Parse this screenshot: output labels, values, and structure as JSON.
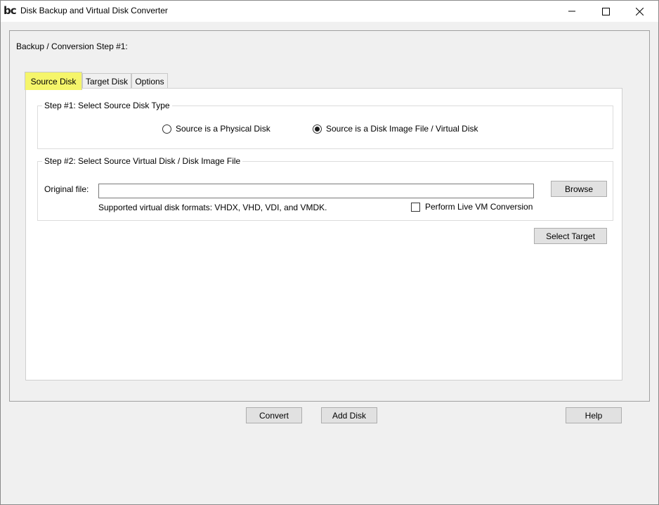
{
  "window": {
    "logo": "bc",
    "title": "Disk Backup and Virtual Disk Converter",
    "controls": [
      "minimize",
      "maximize",
      "close"
    ]
  },
  "step_heading": "Backup / Conversion Step #1:",
  "tabs": [
    {
      "label": "Source Disk",
      "selected": true
    },
    {
      "label": "Target Disk",
      "selected": false
    },
    {
      "label": "Options",
      "selected": false
    }
  ],
  "source_type_group": {
    "legend": "Step #1: Select Source Disk Type",
    "options": [
      {
        "label": "Source is a Physical Disk",
        "selected": false
      },
      {
        "label": "Source is a Disk Image File / Virtual Disk",
        "selected": true
      }
    ]
  },
  "source_file_group": {
    "legend": "Step #2: Select Source Virtual Disk / Disk Image File",
    "original_file_label": "Original file:",
    "original_file_value": "",
    "browse_label": "Browse",
    "formats_note": "Supported virtual disk formats: VHDX, VHD, VDI, and VMDK.",
    "live_vm_label": "Perform Live VM Conversion",
    "live_vm_checked": false
  },
  "select_target_label": "Select Target",
  "footer": {
    "convert_label": "Convert",
    "add_disk_label": "Add Disk",
    "help_label": "Help"
  },
  "colors": {
    "selected_tab_highlight": "#f5f56a",
    "window_background": "#f0f0f0",
    "button_face": "#e1e1e1"
  }
}
